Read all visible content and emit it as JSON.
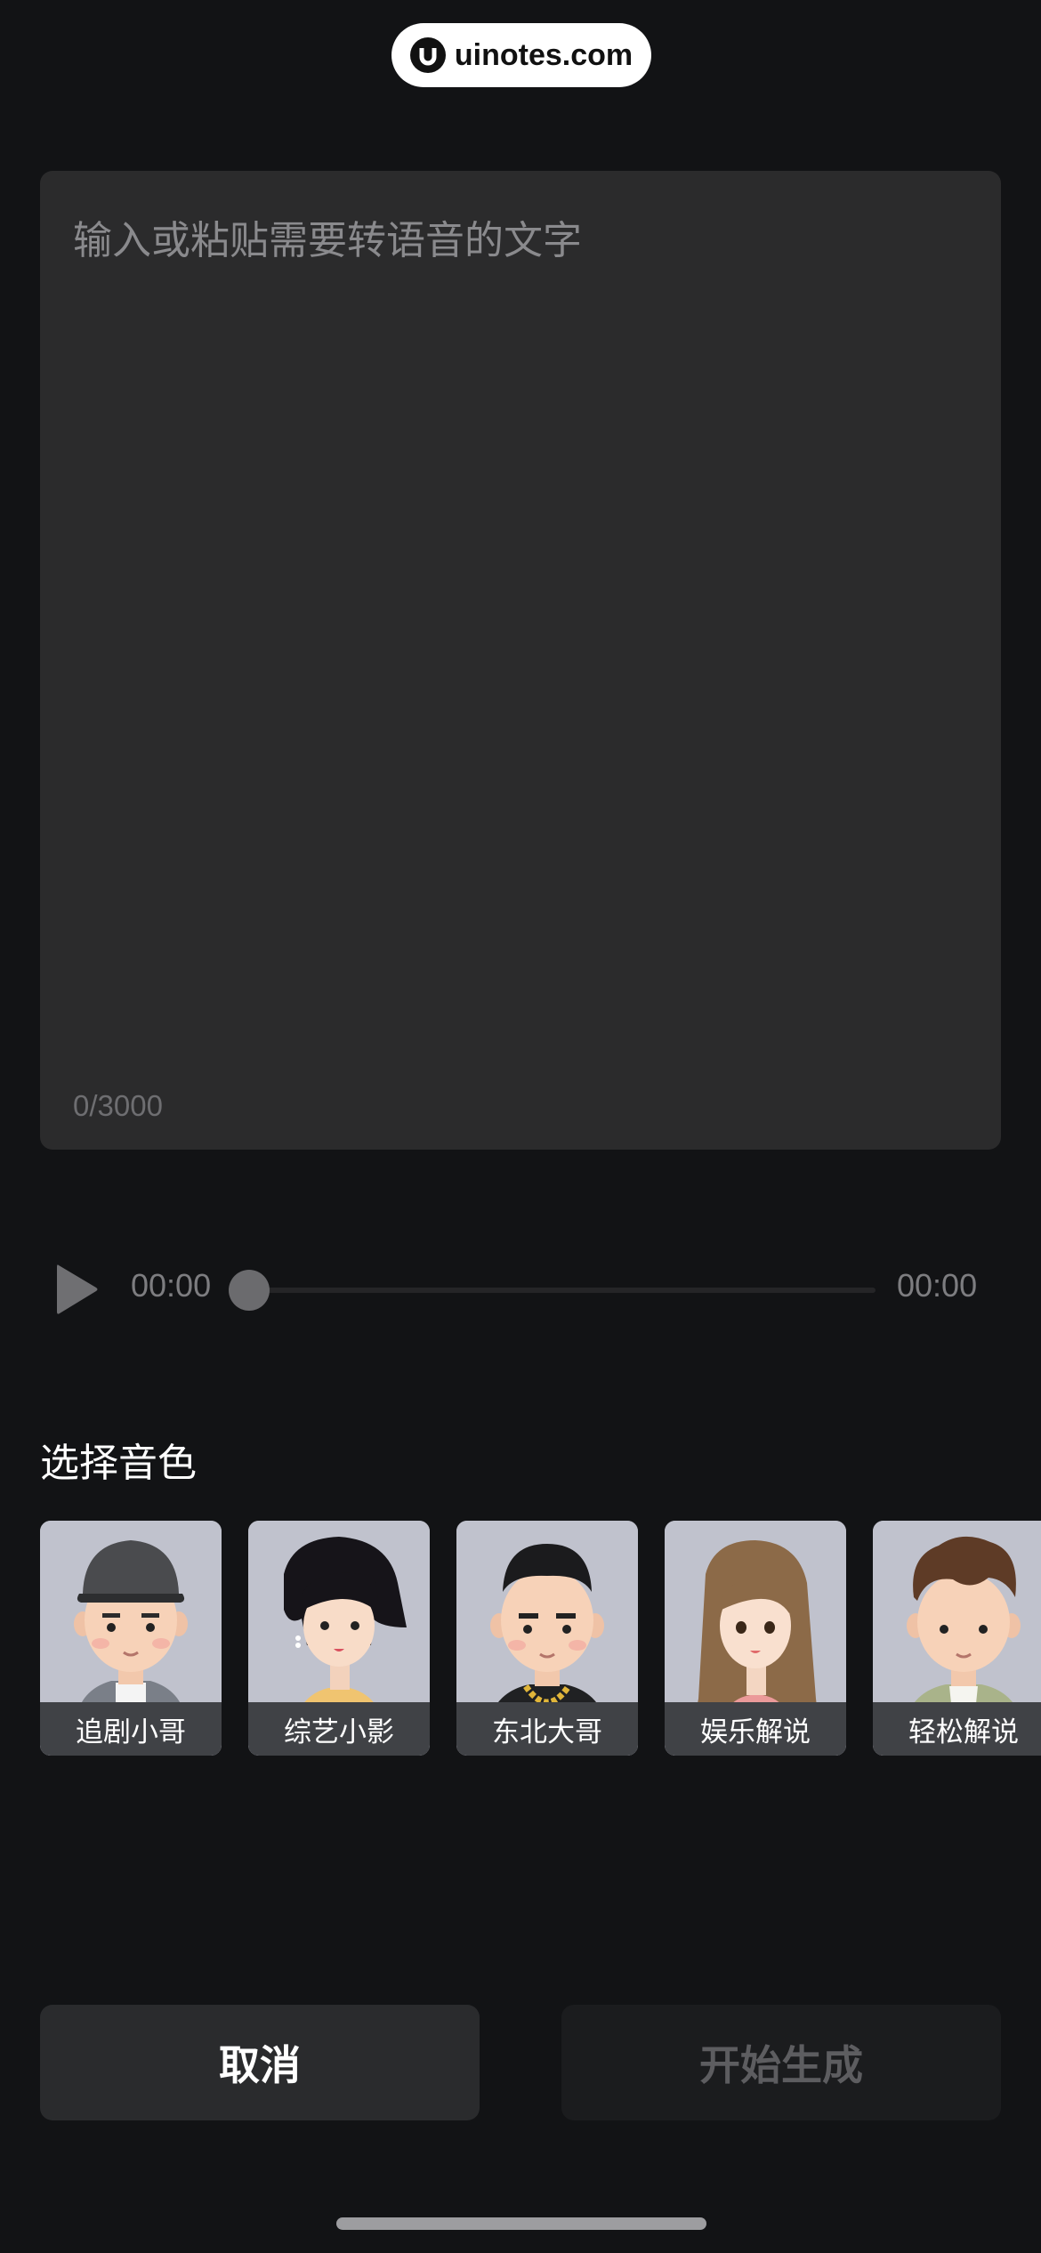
{
  "watermark": {
    "text": "uinotes.com"
  },
  "editor": {
    "placeholder": "输入或粘贴需要转语音的文字",
    "counter": "0/3000"
  },
  "player": {
    "current_time": "00:00",
    "total_time": "00:00",
    "progress": 0
  },
  "voice_section": {
    "title": "选择音色",
    "voices": [
      {
        "label": "追剧小哥",
        "avatar": "boy-cap-avatar"
      },
      {
        "label": "综艺小影",
        "avatar": "girl-bob-avatar"
      },
      {
        "label": "东北大哥",
        "avatar": "man-chain-avatar"
      },
      {
        "label": "娱乐解说",
        "avatar": "woman-long-hair-avatar"
      },
      {
        "label": "轻松解说",
        "avatar": "man-curly-hair-avatar"
      }
    ]
  },
  "actions": {
    "cancel_label": "取消",
    "start_label": "开始生成"
  },
  "colors": {
    "background": "#121315",
    "panel": "#2b2b2c",
    "card_bg": "#bfc1cc"
  }
}
